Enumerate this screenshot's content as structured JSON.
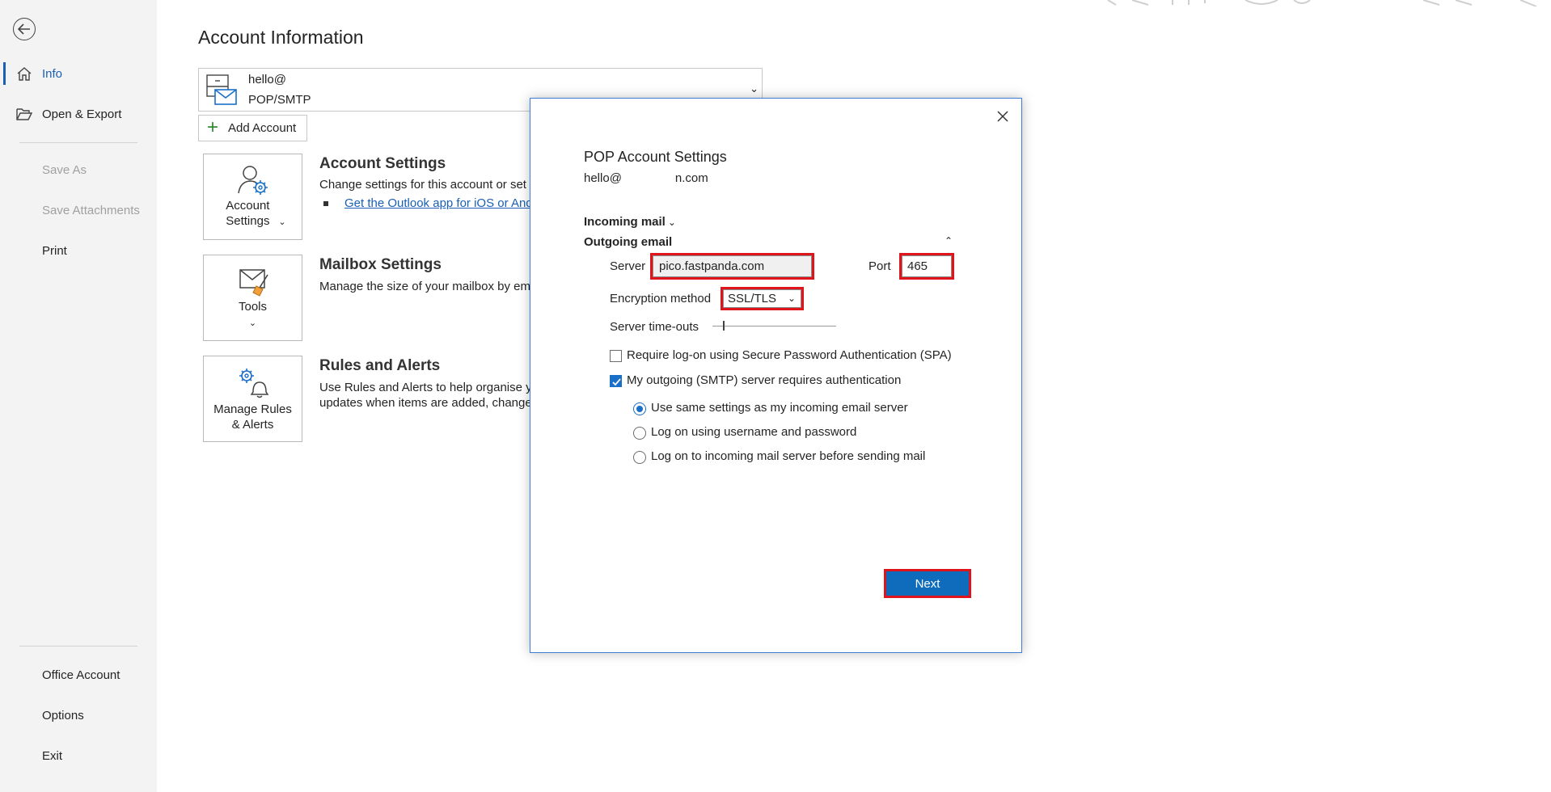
{
  "nav": {
    "items": [
      {
        "label": "Info"
      },
      {
        "label": "Open & Export"
      },
      {
        "label": "Save As"
      },
      {
        "label": "Save Attachments"
      },
      {
        "label": "Print"
      },
      {
        "label": "Office Account"
      },
      {
        "label": "Options"
      },
      {
        "label": "Exit"
      }
    ]
  },
  "main": {
    "title": "Account Information",
    "account": {
      "email": "hello@",
      "type": "POP/SMTP"
    },
    "add_account_label": "Add Account",
    "tiles": {
      "account_settings": "Account Settings",
      "tools": "Tools",
      "rules": "Manage Rules & Alerts"
    },
    "sections": {
      "account_settings_title": "Account Settings",
      "account_settings_desc": "Change settings for this account or set u",
      "account_settings_link": "Get the Outlook app for iOS or And",
      "mailbox_title": "Mailbox Settings",
      "mailbox_desc": "Manage the size of your mailbox by em",
      "rules_title": "Rules and Alerts",
      "rules_desc_1": "Use Rules and Alerts to help organise yo",
      "rules_desc_2": "updates when items are added, change"
    }
  },
  "dialog": {
    "title": "POP Account Settings",
    "email_prefix": "hello@",
    "email_suffix": "n.com",
    "incoming_label": "Incoming mail",
    "outgoing_label": "Outgoing email",
    "server_label": "Server",
    "server_value": "pico.fastpanda.com",
    "port_label": "Port",
    "port_value": "465",
    "encryption_label": "Encryption method",
    "encryption_value": "SSL/TLS",
    "timeouts_label": "Server time-outs",
    "spa_label": "Require log-on using Secure Password Authentication (SPA)",
    "spa_checked": false,
    "smtp_auth_label": "My outgoing (SMTP) server requires authentication",
    "smtp_auth_checked": true,
    "radio_options": [
      {
        "label": "Use same settings as my incoming email server",
        "selected": true
      },
      {
        "label": "Log on using username and password",
        "selected": false
      },
      {
        "label": "Log on to incoming mail server before sending mail",
        "selected": false
      }
    ],
    "next_label": "Next"
  },
  "colors": {
    "accent": "#1a5fb4",
    "button": "#0f6cbd",
    "highlight": "#e0141b",
    "nav_bg": "#f3f3f3"
  }
}
